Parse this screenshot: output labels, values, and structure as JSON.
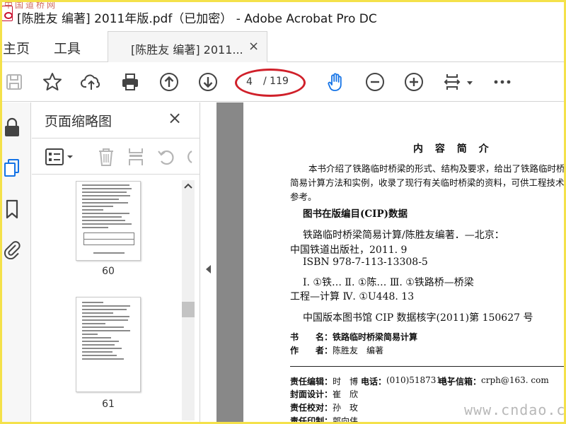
{
  "window": {
    "title": "[陈胜友 编著] 2011年版.pdf（已加密） - Adobe Acrobat Pro DC",
    "watermark_top_left": "中国道桥网"
  },
  "menu": {
    "home": "主页",
    "tools": "工具"
  },
  "tab": {
    "label": "[陈胜友 编著] 2011...",
    "close": "×"
  },
  "toolbar": {
    "icons": [
      "save-icon",
      "bookmark-star-icon",
      "upload-icon",
      "print-icon",
      "page-up-icon",
      "page-down-icon",
      "hand-tool-icon",
      "zoom-out-icon",
      "zoom-in-icon",
      "fit-page-icon",
      "more-icon"
    ],
    "page_current": "4",
    "page_total": "/ 119",
    "accent_blue": "#1473e6",
    "highlight_red": "#d0202a"
  },
  "thumbnail_panel": {
    "title": "页面缩略图",
    "close": "×",
    "thumbnails": [
      {
        "page": "60"
      },
      {
        "page": "61"
      }
    ]
  },
  "document": {
    "heading": "内 容 简 介",
    "intro": [
      "本书介绍了铁路临时桥梁的形式、结构及要求，给出了铁路临时桥",
      "简易计算方法和实例，收录了现行有关临时桥梁的资料，可供工程技术",
      "参考。"
    ],
    "cip_title": "图书在版编目(CIP)数据",
    "cip_lines": [
      "铁路临时桥梁简易计算/陈胜友编著．—北京：",
      "中国铁道出版社，2011. 9",
      "ISBN 978-7-113-13308-5",
      "Ⅰ. ①铁…   Ⅱ. ①陈…   Ⅲ. ①铁路桥—桥梁",
      "工程—计算   Ⅳ. ①U448. 13",
      "中国版本图书馆 CIP 数据核字(2011)第 150627 号"
    ],
    "book_name_label": "书　　名：",
    "book_name": "铁路临时桥梁简易计算",
    "author_label": "作　　者：",
    "author": "陈胜友　编著",
    "editor_label": "责任编辑：",
    "editor": "时　博",
    "phone_label": "电话：",
    "phone": "(010)51873141",
    "email_label": "电子信箱：",
    "email": "crph@163. com",
    "cover_label": "封面设计：",
    "cover": "崔　欣",
    "proof_label": "责任校对：",
    "proof": "孙　玫",
    "print_label": "责任印制：",
    "print": "郭向伟"
  },
  "watermark_bottom_right": "www.cndao.com"
}
